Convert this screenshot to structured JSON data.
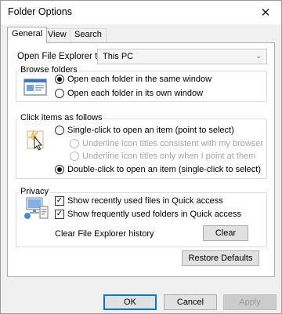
{
  "window": {
    "title": "Folder Options",
    "close_glyph": "✕",
    "close_icon": "close-icon"
  },
  "tabs": [
    {
      "label": "General",
      "active": true
    },
    {
      "label": "View",
      "active": false
    },
    {
      "label": "Search",
      "active": false
    }
  ],
  "open_in": {
    "label": "Open File Explorer to:",
    "value": "This PC",
    "arrow_glyph": "⌄"
  },
  "browse_folders": {
    "title": "Browse folders",
    "icon": "browse-folders-icon",
    "options": [
      {
        "label": "Open each folder in the same window",
        "selected": true
      },
      {
        "label": "Open each folder in its own window",
        "selected": false
      }
    ]
  },
  "click_items": {
    "title": "Click items as follows",
    "icon": "click-pointer-icon",
    "single_click": {
      "label": "Single-click to open an item (point to select)",
      "selected": false
    },
    "underline_options": [
      {
        "label": "Underline icon titles consistent with my browser",
        "enabled": false
      },
      {
        "label": "Underline icon titles only when I point at them",
        "enabled": false
      }
    ],
    "double_click": {
      "label": "Double-click to open an item (single-click to select)",
      "selected": true
    }
  },
  "privacy": {
    "title": "Privacy",
    "icon": "privacy-icon",
    "checks": [
      {
        "label": "Show recently used files in Quick access",
        "checked": true
      },
      {
        "label": "Show frequently used folders in Quick access",
        "checked": true
      }
    ],
    "clear_history_label": "Clear File Explorer history",
    "clear_button": "Clear"
  },
  "restore_defaults": "Restore Defaults",
  "footer": {
    "ok": "OK",
    "cancel": "Cancel",
    "apply": "Apply"
  },
  "colors": {
    "accent": "#0078d7",
    "window_bg": "#f0f0f0",
    "panel_bg": "#ffffff"
  },
  "check_glyph": "✓"
}
